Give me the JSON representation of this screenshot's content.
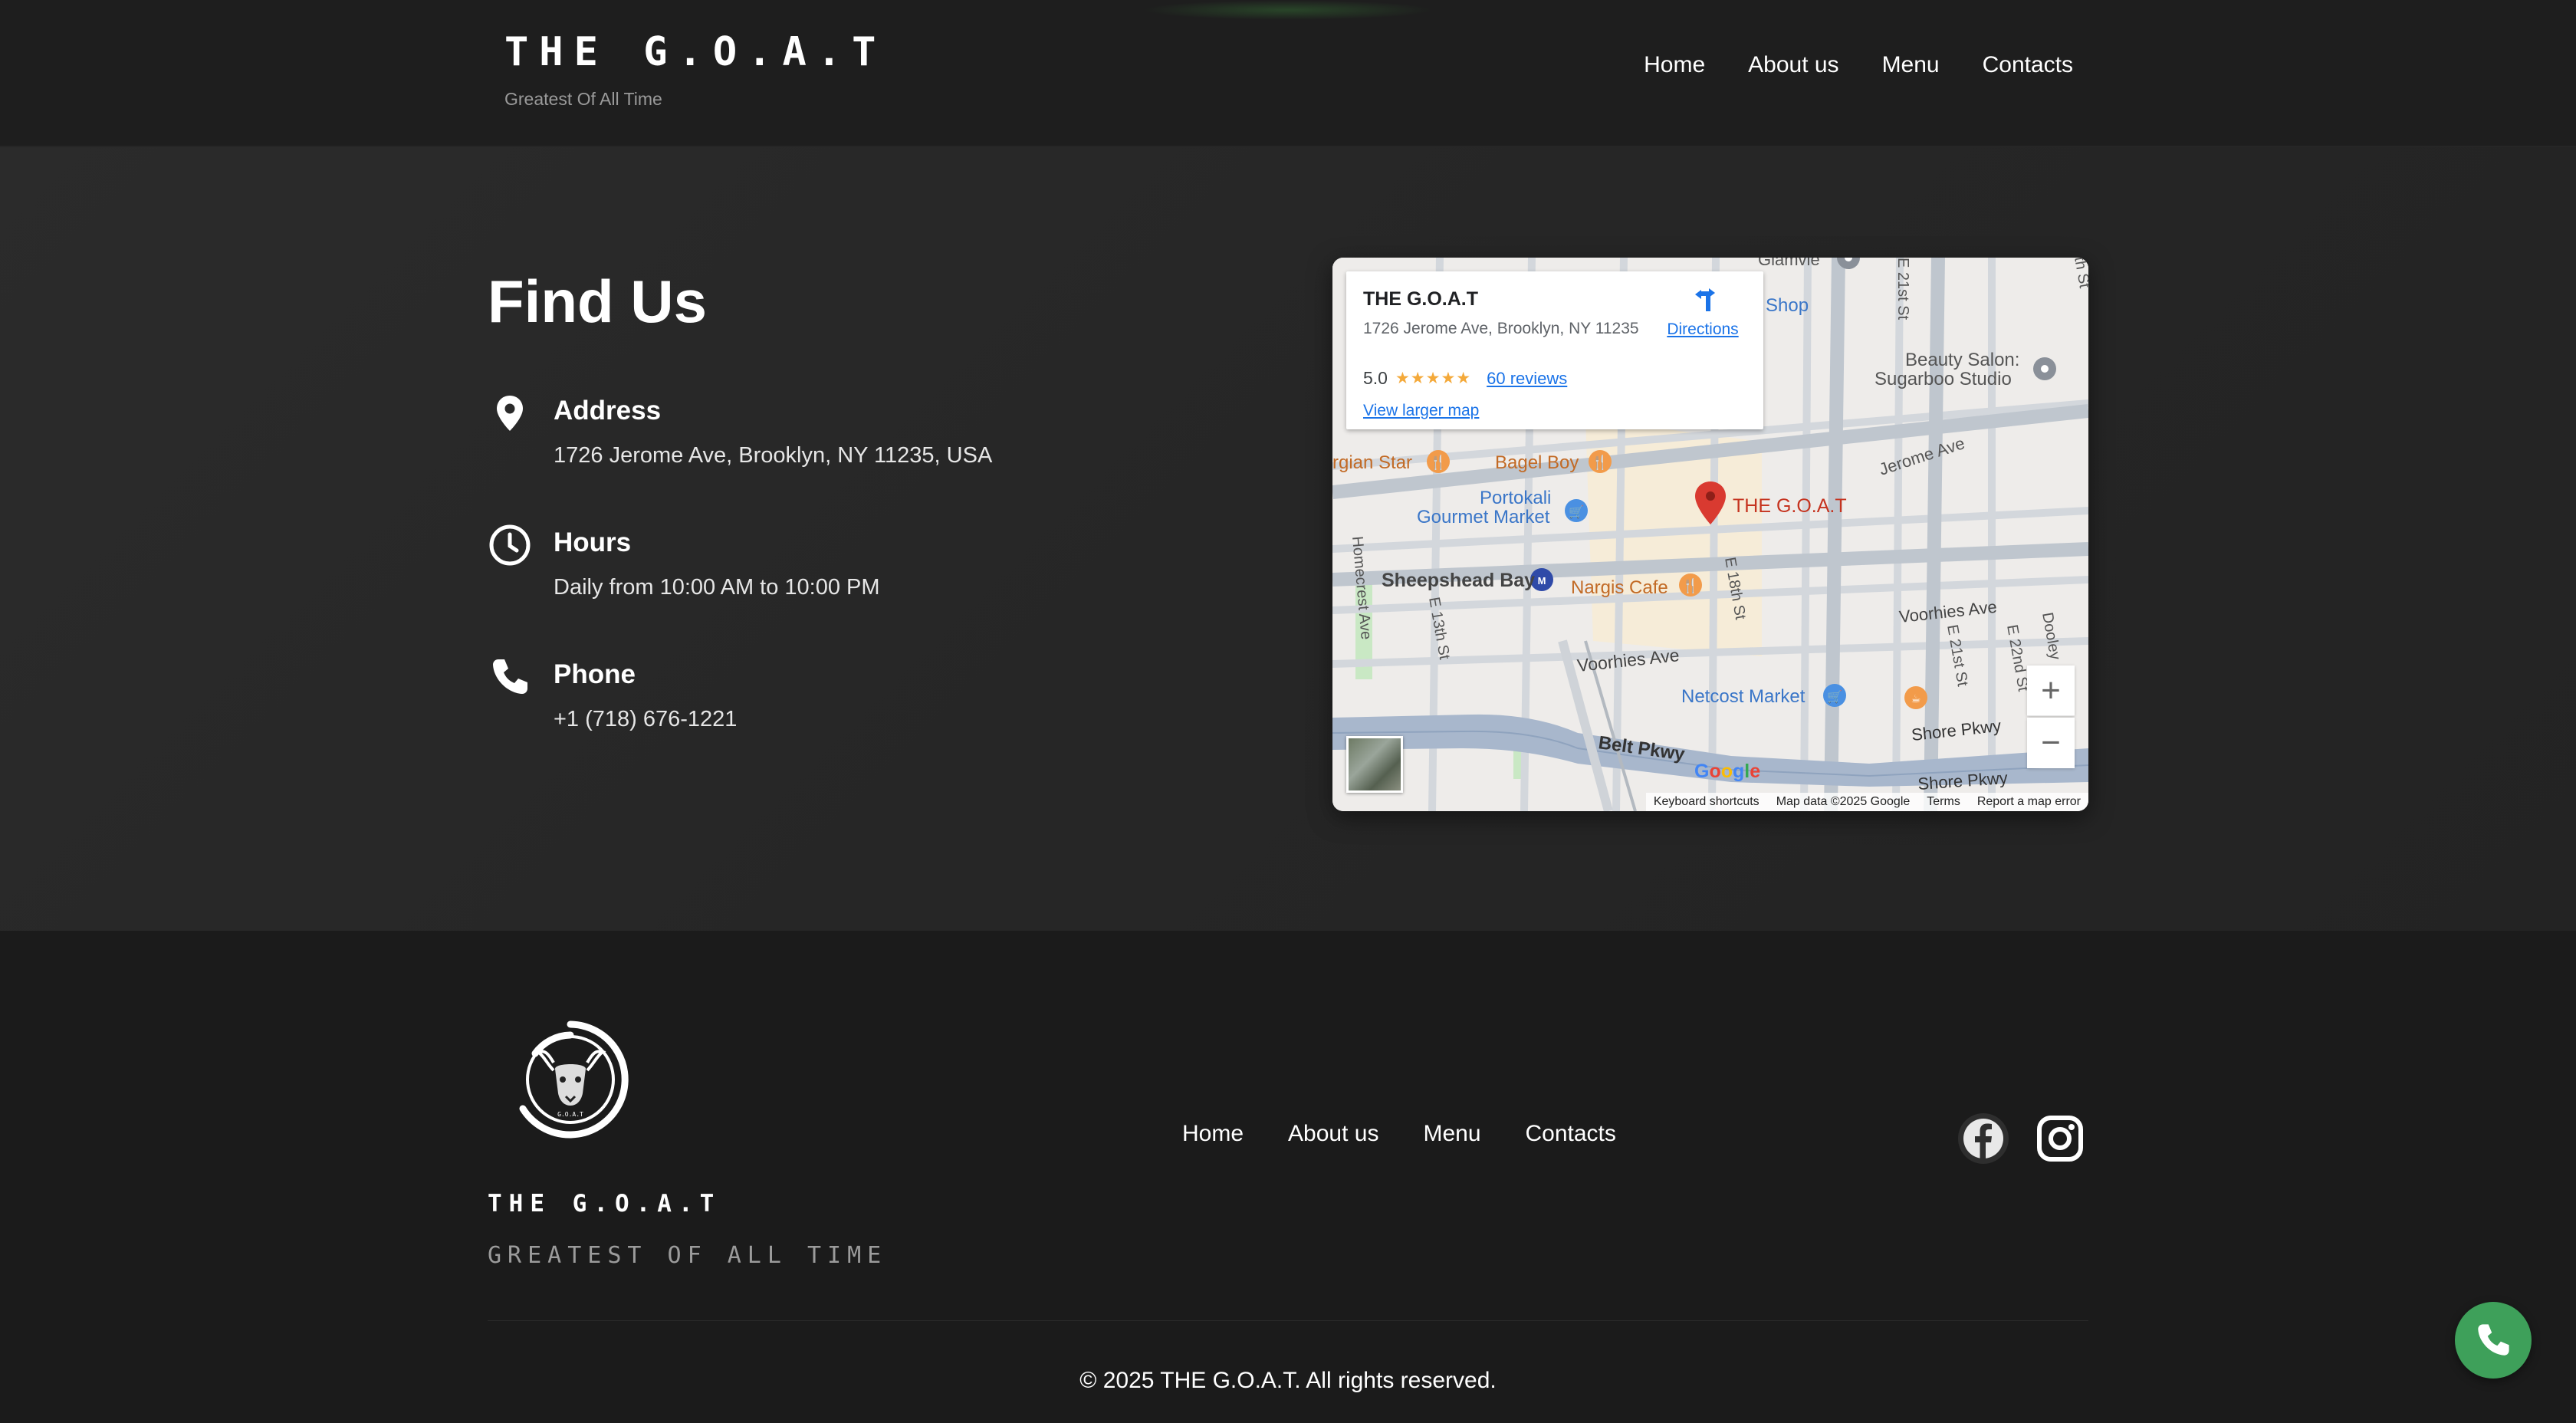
{
  "header": {
    "logo": "THE G.O.A.T",
    "tagline": "Greatest Of All Time",
    "nav": [
      "Home",
      "About us",
      "Menu",
      "Contacts"
    ]
  },
  "find_us": {
    "title": "Find Us",
    "address_label": "Address",
    "address_value": "1726 Jerome Ave, Brooklyn, NY 11235, USA",
    "hours_label": "Hours",
    "hours_value": "Daily from 10:00 AM to 10:00 PM",
    "phone_label": "Phone",
    "phone_value": "+1 (718) 676-1221"
  },
  "map": {
    "place_name": "THE G.O.A.T",
    "place_address": "1726 Jerome Ave, Brooklyn, NY 11235",
    "rating": "5.0",
    "stars": "★★★★★",
    "reviews": "60 reviews",
    "view_larger": "View larger map",
    "directions": "Directions",
    "zoom_in": "+",
    "zoom_out": "−",
    "labels": {
      "marker": "THE G.O.A.T",
      "bagel_boy": "Bagel Boy",
      "georgian_star": "rgian Star",
      "portokali": "Portokali",
      "gourmet_market": "Gourmet Market",
      "sheepshead": "Sheepshead Bay",
      "nargis": "Nargis Cafe",
      "netcost": "Netcost Market",
      "beauty1": "Beauty Salon:",
      "beauty2": "Sugarboo Studio",
      "shop": "Shop",
      "glamvie": "Glamvie",
      "jerome_ave": "Jerome Ave",
      "voorhies1": "Voorhies Ave",
      "voorhies2": "Voorhies Ave",
      "belt_pkwy": "Belt Pkwy",
      "shore1": "Shore Pkwy",
      "shore2": "Shore Pkwy",
      "e21st_top": "E 21st St",
      "e21st_bottom": "E 21st St",
      "e22nd": "E 22nd St",
      "e18th": "E 18th St",
      "e13th": "E 13th St",
      "homecrest": "Homecrest Ave",
      "dooley": "Dooley",
      "th_st": "th St"
    },
    "footer": {
      "shortcuts": "Keyboard shortcuts",
      "data": "Map data ©2025 Google",
      "terms": "Terms",
      "report": "Report a map error"
    }
  },
  "footer": {
    "name": "THE G.O.A.T",
    "tagline": "GREATEST OF ALL TIME",
    "nav": [
      "Home",
      "About us",
      "Menu",
      "Contacts"
    ],
    "copyright": "© 2025 THE G.O.A.T. All rights reserved."
  },
  "icons": [
    "location-pin-icon",
    "clock-icon",
    "phone-icon",
    "facebook-icon",
    "instagram-icon",
    "directions-icon",
    "call-icon"
  ],
  "colors": {
    "background": "#1c1c1c",
    "accent_green": "#3ea05a",
    "map_marker": "#d93a30",
    "link_blue": "#1a73e8"
  }
}
